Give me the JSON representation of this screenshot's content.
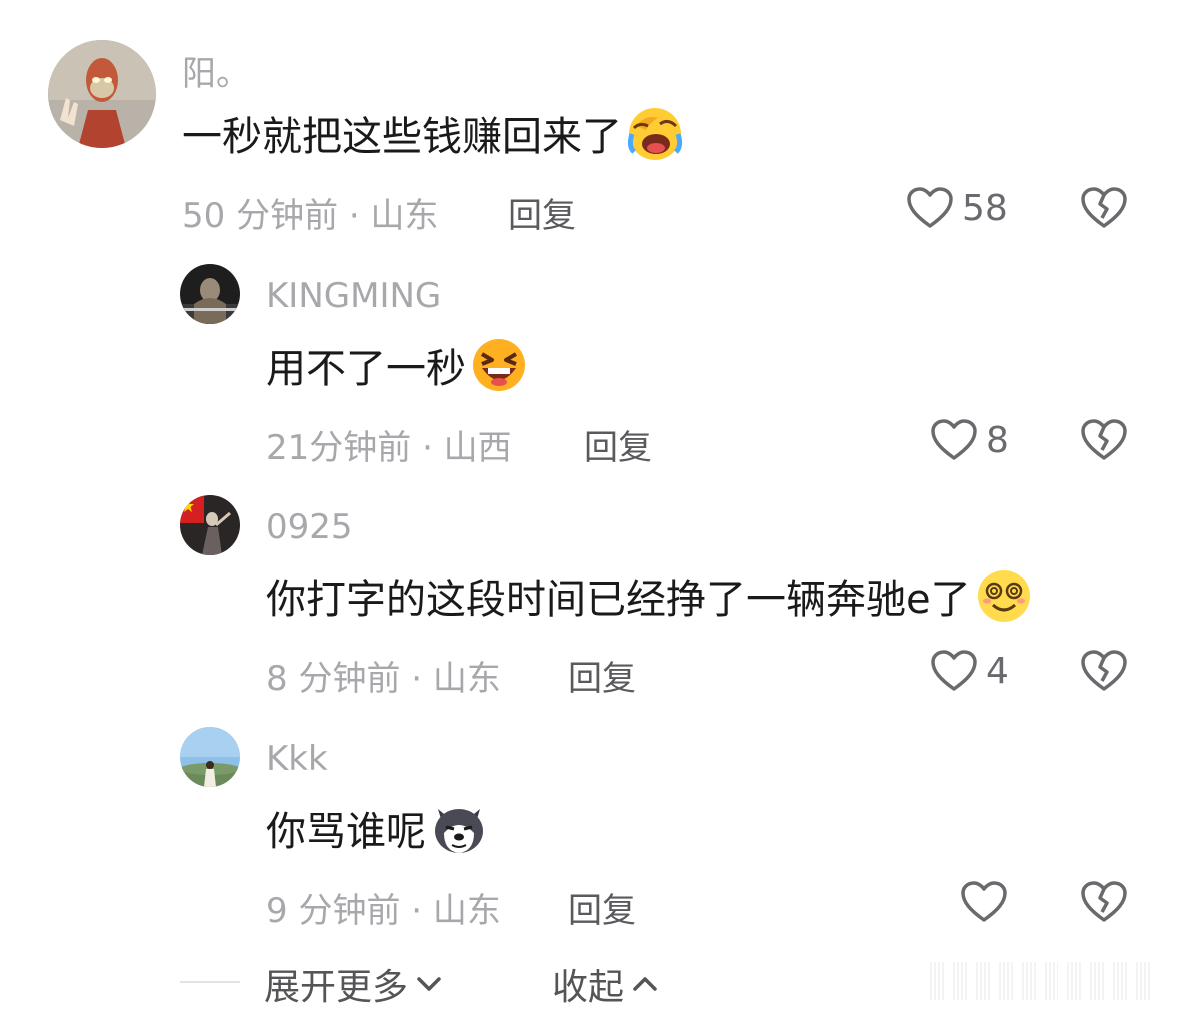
{
  "comments": [
    {
      "username": "阳。",
      "text": "一秒就把这些钱赚回来了",
      "emoji": "laughing-crying-emoji",
      "time_location": "50 分钟前 · 山东",
      "reply_label": "回复",
      "likes": "58"
    },
    {
      "username": "KINGMING",
      "text": "用不了一秒",
      "emoji": "grinning-squint-emoji",
      "time_location": "21分钟前 · 山西",
      "reply_label": "回复",
      "likes": "8"
    },
    {
      "username": "0925",
      "text": "你打字的这段时间已经挣了一辆奔驰e了",
      "emoji": "dizzy-smile-emoji",
      "time_location": "8 分钟前 · 山东",
      "reply_label": "回复",
      "likes": "4"
    },
    {
      "username": "Kkk",
      "text": "你骂谁呢",
      "emoji": "husky-face-emoji",
      "time_location": "9 分钟前 · 山东",
      "reply_label": "回复",
      "likes": ""
    }
  ],
  "footer": {
    "expand_label": "展开更多",
    "collapse_label": "收起"
  },
  "icons": {
    "like": "heart-outline-icon",
    "dislike": "broken-heart-icon",
    "expand": "chevron-down-icon",
    "collapse": "chevron-up-icon"
  },
  "colors": {
    "username": "#a8a8ac",
    "text": "#1a1a1a",
    "meta": "#a8a8ac",
    "icon": "#6a6a6e"
  }
}
